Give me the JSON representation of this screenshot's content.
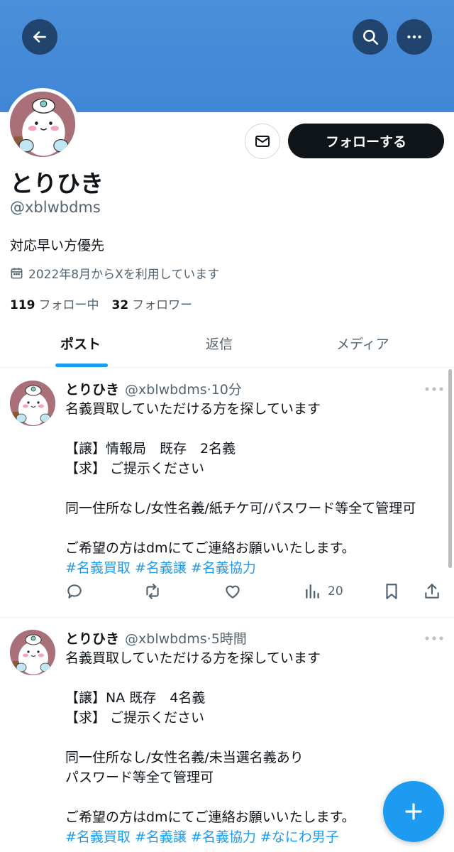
{
  "profile": {
    "display_name": "とりひき",
    "handle": "@xblwbdms",
    "bio": "対応早い方優先",
    "joined": "2022年8月からXを利用しています",
    "following_count": "119",
    "following_label": "フォロー中",
    "followers_count": "32",
    "followers_label": "フォロワー",
    "follow_button": "フォローする"
  },
  "tabs": [
    {
      "label": "ポスト",
      "active": true
    },
    {
      "label": "返信",
      "active": false
    },
    {
      "label": "メディア",
      "active": false
    }
  ],
  "tweets": [
    {
      "name": "とりひき",
      "meta": "@xblwbdms·10分",
      "lines": [
        "名義買取していただける方を探しています",
        "",
        "【譲】情報局　既存　2名義",
        "【求】 ご提示ください",
        "",
        "同一住所なし/女性名義/紙チケ可/パスワード等全て管理可",
        "",
        "ご希望の方はdmにてご連絡お願いいたします。"
      ],
      "hashtags": "#名義買取 #名義譲 #名義協力",
      "views": "20"
    },
    {
      "name": "とりひき",
      "meta": "@xblwbdms·5時間",
      "lines": [
        "名義買取していただける方を探しています",
        "",
        "【譲】NA 既存　4名義",
        "【求】 ご提示ください",
        "",
        "同一住所なし/女性名義/未当選名義あり",
        "パスワード等全て管理可",
        "",
        "ご希望の方はdmにてご連絡お願いいたします。"
      ],
      "hashtags": "#名義買取 #名義譲 #名義協力 #なにわ男子"
    }
  ],
  "icons": {
    "back": "arrow-left-icon",
    "search": "search-icon",
    "more": "more-horizontal-icon",
    "message": "mail-icon",
    "calendar": "calendar-icon",
    "reply": "reply-icon",
    "repost": "repost-icon",
    "like": "heart-icon",
    "views": "views-icon",
    "bookmark": "bookmark-icon",
    "share": "share-icon",
    "compose": "plus-icon"
  },
  "colors": {
    "banner": "#4a8fd8",
    "accent": "#1d9bf0",
    "primary_text": "#0f1419",
    "secondary_text": "#536471"
  }
}
